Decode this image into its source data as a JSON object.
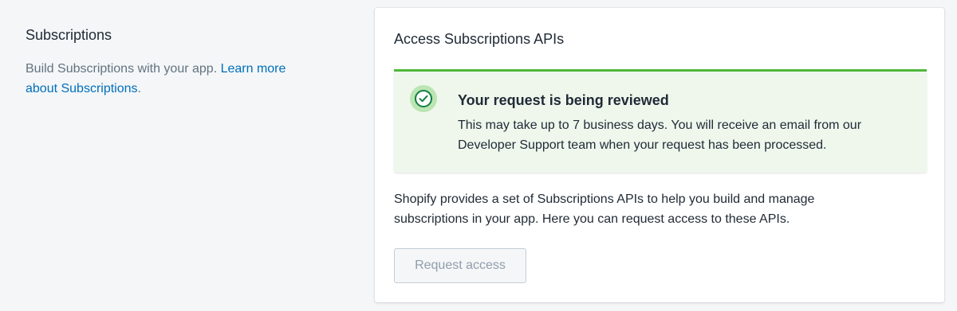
{
  "section": {
    "title": "Subscriptions",
    "description_prefix": "Build Subscriptions with your app.",
    "learn_more_link": "Learn more about Subscriptions",
    "description_suffix": "."
  },
  "card": {
    "title": "Access Subscriptions APIs",
    "banner": {
      "status": "success",
      "icon": "check-circle-icon",
      "title": "Your request is being reviewed",
      "body": "This may take up to 7 business days. You will receive an email from our Developer Support team when your request has been processed."
    },
    "description": "Shopify provides a set of Subscriptions APIs to help you build and manage subscriptions in your app. Here you can request access to these APIs.",
    "button": {
      "label": "Request access",
      "state": "disabled"
    }
  },
  "colors": {
    "background": "#f4f6f8",
    "link": "#006fbb",
    "banner_background": "#eff7ed",
    "banner_accent": "#50b83c",
    "success_icon": "#108043",
    "disabled_text": "#919eab"
  }
}
